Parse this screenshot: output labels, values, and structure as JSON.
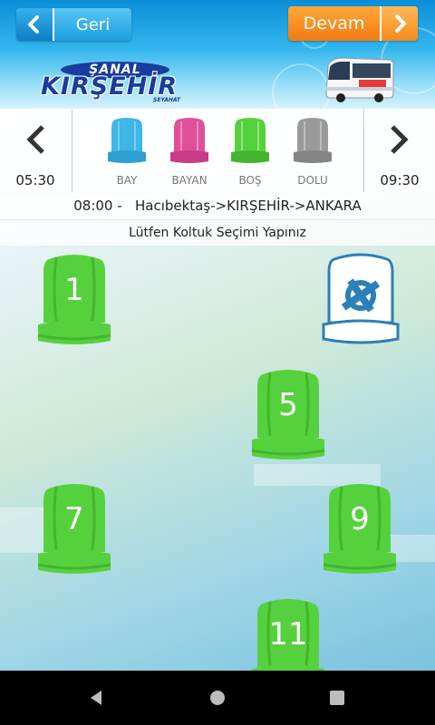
{
  "header": {
    "back_label": "Geri",
    "next_label": "Devam",
    "logo_top": "ŞANAL",
    "logo_main": "KIRŞEHİR",
    "logo_sub": "SEYAHAT"
  },
  "legend": {
    "prev_time": "05:30",
    "next_time": "09:30",
    "items": [
      {
        "label": "BAY",
        "color": "#3fb6e6"
      },
      {
        "label": "BAYAN",
        "color": "#e0509a"
      },
      {
        "label": "BOŞ",
        "color": "#56d13e"
      },
      {
        "label": "DOLU",
        "color": "#9a9a9a"
      }
    ]
  },
  "trip": {
    "time": "08:00 -",
    "route": "Hacıbektaş->KIRŞEHİR->ANKARA"
  },
  "notice": "Lütfen Koltuk Seçimi Yapınız",
  "seats": [
    {
      "number": "1",
      "status": "BOŞ"
    },
    {
      "number": "5",
      "status": "BOŞ"
    },
    {
      "number": "7",
      "status": "BOŞ"
    },
    {
      "number": "9",
      "status": "BOŞ"
    },
    {
      "number": "11",
      "status": "BOŞ"
    }
  ],
  "colors": {
    "seat_empty": "#56d13e",
    "accent_blue": "#1b9ee0",
    "accent_orange": "#f27a10"
  }
}
